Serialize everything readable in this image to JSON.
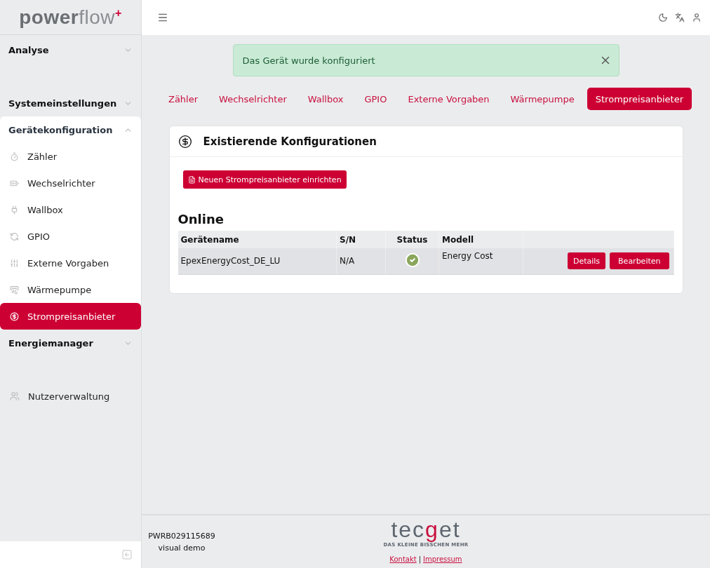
{
  "logo": {
    "primary": "power",
    "secondary": "flow",
    "mark": "+"
  },
  "sidebar": {
    "sections": [
      {
        "kind": "group",
        "label": "Analyse",
        "expanded": false
      },
      {
        "kind": "group",
        "label": "Systemeinstellungen",
        "expanded": false
      },
      {
        "kind": "group",
        "label": "Gerätekonfiguration",
        "expanded": true,
        "children": [
          {
            "label": "Zähler",
            "selected": false
          },
          {
            "label": "Wechselrichter",
            "selected": false
          },
          {
            "label": "Wallbox",
            "selected": false
          },
          {
            "label": "GPIO",
            "selected": false
          },
          {
            "label": "Externe Vorgaben",
            "selected": false
          },
          {
            "label": "Wärmepumpe",
            "selected": false
          },
          {
            "label": "Strompreisanbieter",
            "selected": true
          }
        ]
      },
      {
        "kind": "group",
        "label": "Energiemanager",
        "expanded": false
      },
      {
        "kind": "link",
        "label": "Nutzerverwaltung"
      }
    ]
  },
  "alert": {
    "message": "Das Gerät wurde konfiguriert"
  },
  "tabs": [
    {
      "label": "Zähler",
      "selected": false
    },
    {
      "label": "Wechselrichter",
      "selected": false
    },
    {
      "label": "Wallbox",
      "selected": false
    },
    {
      "label": "GPIO",
      "selected": false
    },
    {
      "label": "Externe Vorgaben",
      "selected": false
    },
    {
      "label": "Wärmepumpe",
      "selected": false
    },
    {
      "label": "Strompreisanbieter",
      "selected": true
    }
  ],
  "card": {
    "title": "Existierende Konfigurationen",
    "new_button": "Neuen Strompreisanbieter einrichten",
    "section_title": "Online",
    "table": {
      "columns": [
        "Gerätename",
        "S/N",
        "Status",
        "Modell"
      ],
      "rows": [
        {
          "name": "EpexEnergyCost_DE_LU",
          "serial": "N/A",
          "online": true,
          "model": "Energy Cost",
          "actions": [
            "Details",
            "Bearbeiten"
          ]
        }
      ]
    }
  },
  "footer": {
    "serial": "PWRB029115689",
    "mode": "visual demo",
    "brand": {
      "start": "tec",
      "accent": "g",
      "end": "et",
      "tagline": "DAS KLEINE BISSCHEN MEHR"
    },
    "links": [
      "Kontakt",
      "Impressum"
    ],
    "separator": "|"
  }
}
